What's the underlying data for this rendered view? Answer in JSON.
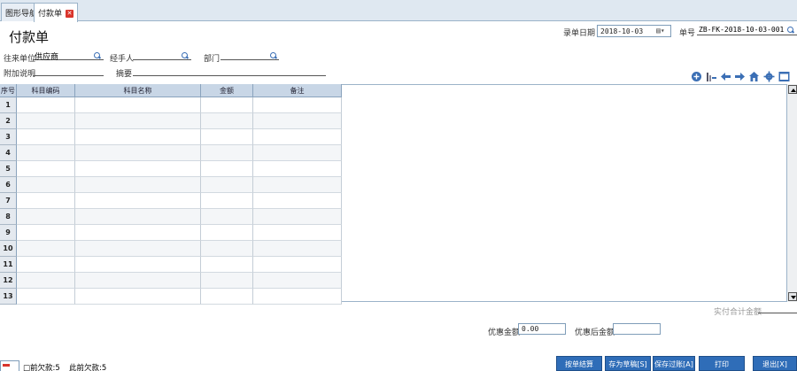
{
  "tabs": [
    {
      "label": "图形导航"
    },
    {
      "label": "付款单"
    }
  ],
  "form": {
    "title": "付款单",
    "record_date_label": "录单日期",
    "record_date_value": "2018-10-03",
    "doc_no_label": "单号",
    "doc_no_value": "ZB-FK-2018-10-03-001",
    "counterparty_label": "往来单位",
    "counterparty_value": "供应商",
    "handler_label": "经手人",
    "handler_value": "",
    "dept_label": "部门",
    "dept_value": "",
    "note_label": "附加说明",
    "summary_label": "摘要"
  },
  "toolbar": {
    "icons": [
      "add-circle-icon",
      "column-settings-icon",
      "arrow-left-icon",
      "arrow-right-icon",
      "home-icon",
      "gear-icon",
      "screen-icon"
    ]
  },
  "grid": {
    "columns": [
      "序号",
      "科目编码",
      "科目名称",
      "金额",
      "备注"
    ],
    "rows": [
      "1",
      "2",
      "3",
      "4",
      "5",
      "6",
      "7",
      "8",
      "9",
      "10",
      "11",
      "12",
      "13"
    ]
  },
  "totals": {
    "actual_total_label": "实付合计金额",
    "discount_label": "优惠金额",
    "discount_value": "0.00",
    "after_discount_label": "优惠后金额",
    "after_discount_value": ""
  },
  "status": {
    "prev_debt": "□前欠款:5",
    "this_debt": "此前欠款:5"
  },
  "buttons": {
    "settle": "按单结算",
    "save_draft": "存为草稿[S]",
    "save_post": "保存过账[A]",
    "print": "打印",
    "exit": "退出[X]"
  },
  "colors": {
    "header_bg": "#c8d6e6",
    "button_bg": "#2f6db8",
    "tab_close": "#d9352c"
  }
}
